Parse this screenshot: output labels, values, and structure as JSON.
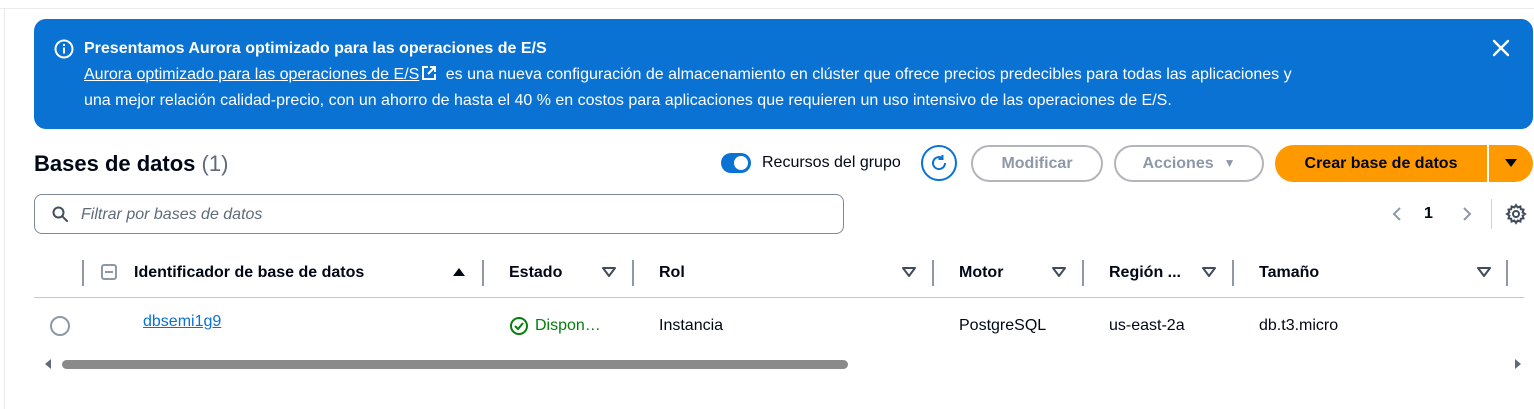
{
  "flash": {
    "title": "Presentamos Aurora optimizado para las operaciones de E/S",
    "link_text": "Aurora optimizado para las operaciones de E/S",
    "body_line1": " es una nueva configuración de almacenamiento en clúster que ofrece precios predecibles para todas las aplicaciones y",
    "body_line2": "una mejor relación calidad-precio, con un ahorro de hasta el 40 % en costos para aplicaciones que requieren un uso intensivo de las operaciones de E/S.",
    "icons": [
      "info-icon",
      "external-link-icon",
      "close-icon"
    ],
    "color": "#0972d3"
  },
  "header": {
    "title": "Bases de datos",
    "count": "(1)",
    "toggle_label": "Recursos del grupo",
    "toggle_on": true,
    "modify_label": "Modificar",
    "actions_label": "Acciones",
    "create_label": "Crear base de datos",
    "primary_color": "#ff9900"
  },
  "search": {
    "placeholder": "Filtrar por bases de datos",
    "value": ""
  },
  "pagination": {
    "current_page": "1"
  },
  "table": {
    "columns": [
      "Identificador de base de datos",
      "Estado",
      "Rol",
      "Motor",
      "Región ...",
      "Tamaño"
    ],
    "rows": [
      {
        "identifier": "dbsemi1g9",
        "status": "Dispon…",
        "role": "Instancia",
        "engine": "PostgreSQL",
        "region": "us-east-2a",
        "size": "db.t3.micro"
      }
    ]
  }
}
